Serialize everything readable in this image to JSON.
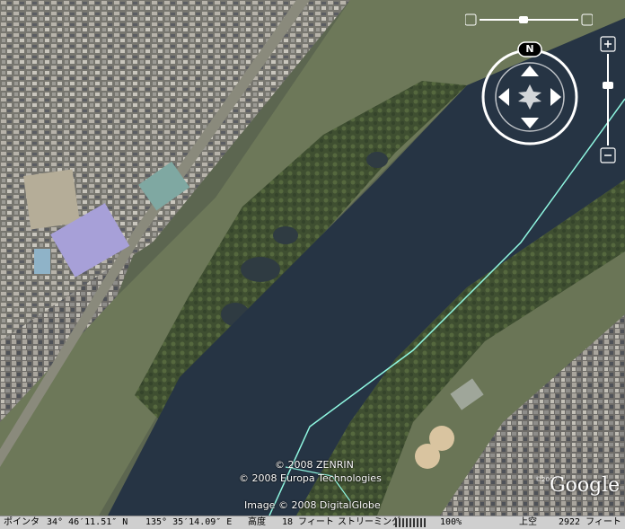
{
  "attribution": {
    "line1": "© 2008 ZENRIN",
    "line2": "© 2008 Europa Technologies",
    "line3": "Image © 2008 DigitalGlobe"
  },
  "logo": {
    "text": "Google",
    "copyright": "©2007"
  },
  "compass": {
    "north_label": "N"
  },
  "statusbar": {
    "pointer_label": "ポインタ",
    "latitude": "34° 46′11.51″ N",
    "longitude": "135° 35′14.09″ E",
    "elevation_label": "高度",
    "elevation_value": "18 フィート",
    "streaming_label": "ストリーミング",
    "streaming_percent": "100%",
    "eye_alt_label": "上空",
    "eye_alt_value": "2922 フィート"
  },
  "zoom": {
    "level": 0.33
  },
  "colors": {
    "river": "#263444",
    "urban": "#7c7a73",
    "vegetation": "#4a5a3a",
    "field": "#6a7556",
    "path_line": "#8ff7e1"
  }
}
